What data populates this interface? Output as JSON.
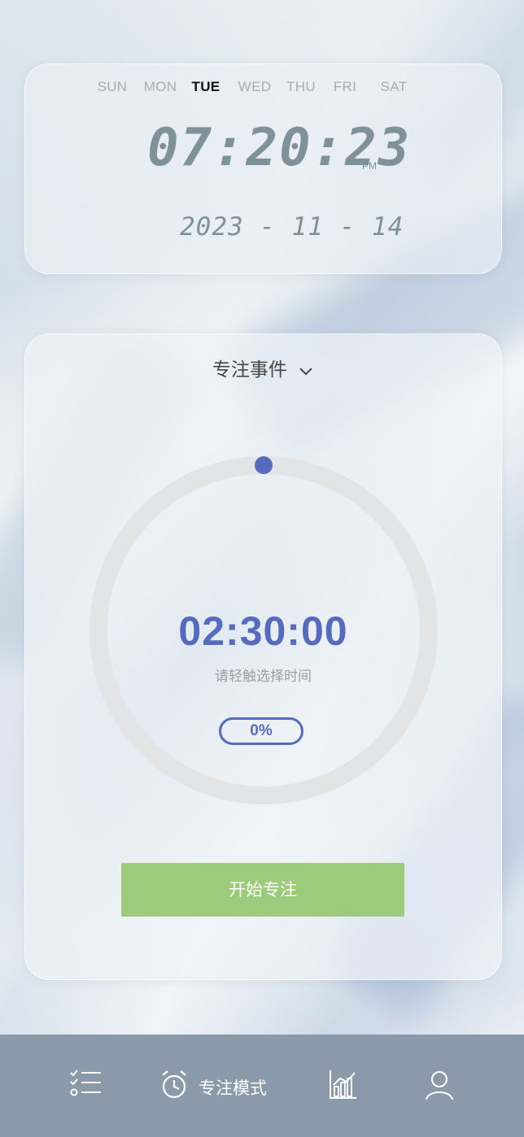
{
  "clock": {
    "weekdays": [
      "SUN",
      "MON",
      "TUE",
      "WED",
      "THU",
      "FRI",
      "SAT"
    ],
    "active_day": "TUE",
    "time": "07:20:23",
    "ampm": "PM",
    "date": "2023 - 11 - 14"
  },
  "focus": {
    "event_label": "专注事件",
    "countdown": "02:30:00",
    "hint": "请轻触选择时间",
    "progress_label": "0%",
    "progress": 0,
    "start_label": "开始专注"
  },
  "tabbar": {
    "tasks_icon": "checklist-icon",
    "focus_icon": "alarm-clock-icon",
    "focus_label": "专注模式",
    "stats_icon": "bar-chart-icon",
    "profile_icon": "user-icon",
    "active": "focus"
  },
  "colors": {
    "accent": "#566bbe",
    "button": "#9dcb7b",
    "tabbar": "#8b9aaa",
    "digits": "#7f9299"
  }
}
